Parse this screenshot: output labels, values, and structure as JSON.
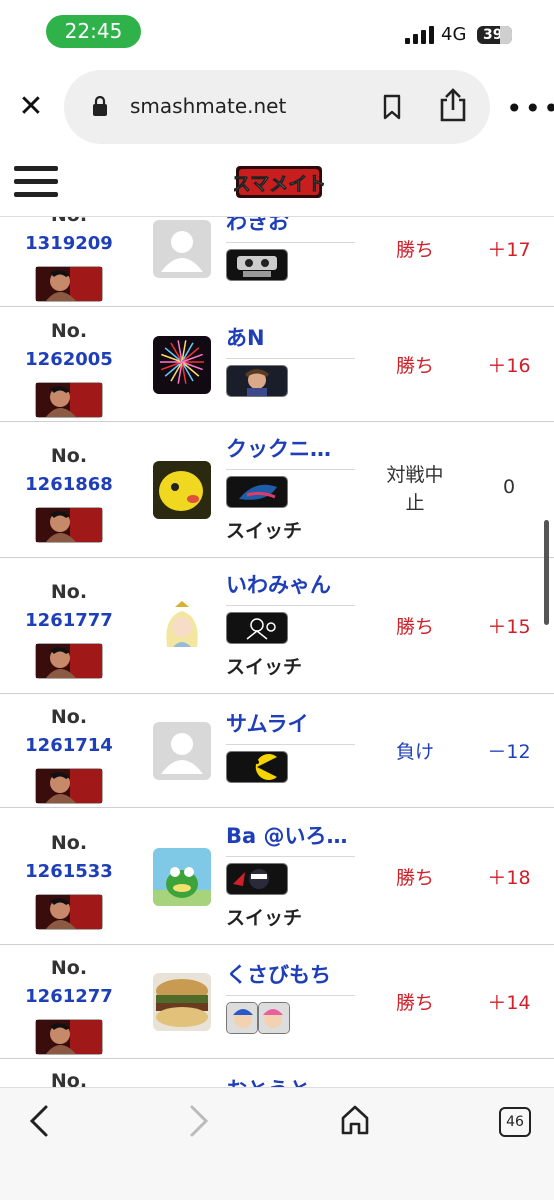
{
  "status": {
    "time": "22:45",
    "network": "4G",
    "battery": "39"
  },
  "browser": {
    "url": "smashmate.net",
    "tab_count": "46"
  },
  "site": {
    "logo_text": "スマメイト"
  },
  "rows": [
    {
      "no_label": "No.",
      "no": "1319209",
      "name": "わきお",
      "platform": "",
      "result": "勝ち",
      "delta": "＋17",
      "outcome": "win",
      "opponent": "rob",
      "avatar": "default"
    },
    {
      "no_label": "No.",
      "no": "1262005",
      "name": "あN",
      "platform": "",
      "result": "勝ち",
      "delta": "＋16",
      "outcome": "win",
      "opponent": "richter",
      "avatar": "fireworks"
    },
    {
      "no_label": "No.",
      "no": "1261868",
      "name": "クックニ…",
      "platform": "スイッチ",
      "result": "対戦中止",
      "delta": "0",
      "outcome": "neutral",
      "opponent": "greninja",
      "avatar": "yellow"
    },
    {
      "no_label": "No.",
      "no": "1261777",
      "name": "いわみゃん",
      "platform": "スイッチ",
      "result": "勝ち",
      "delta": "＋15",
      "outcome": "win",
      "opponent": "game-and-watch",
      "avatar": "rosalina"
    },
    {
      "no_label": "No.",
      "no": "1261714",
      "name": "サムライ",
      "platform": "",
      "result": "負け",
      "delta": "－12",
      "outcome": "lose",
      "opponent": "pacman",
      "avatar": "default"
    },
    {
      "no_label": "No.",
      "no": "1261533",
      "name": "Ba @いろ…",
      "platform": "スイッチ",
      "result": "勝ち",
      "delta": "＋18",
      "outcome": "win",
      "opponent": "joker",
      "avatar": "frog"
    },
    {
      "no_label": "No.",
      "no": "1261277",
      "name": "くさびもち",
      "platform": "",
      "result": "勝ち",
      "delta": "＋14",
      "outcome": "win",
      "opponent": "ice-climbers",
      "avatar": "burger"
    },
    {
      "no_label": "No.",
      "no": "",
      "name": "おとうと",
      "platform": "",
      "result": "",
      "delta": "",
      "outcome": "win",
      "opponent": "",
      "avatar": ""
    }
  ],
  "colors": {
    "win": "#d0202a",
    "lose": "#1e3fb8",
    "link": "#1e3fb8",
    "status_pill": "#2fb24a"
  }
}
